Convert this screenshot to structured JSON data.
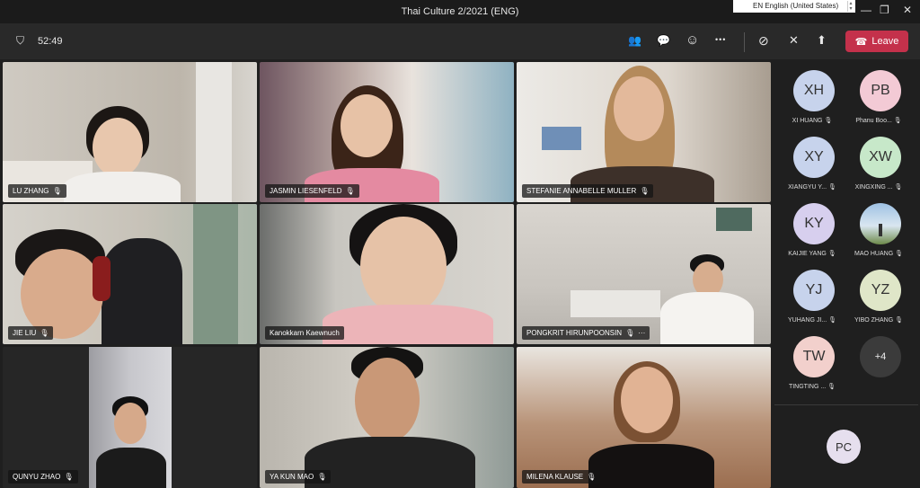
{
  "window": {
    "title": "Thai Culture 2/2021 (ENG)",
    "language_label": "EN English (United States)",
    "minimize_glyph": "—",
    "maximize_glyph": "❐",
    "close_glyph": "✕"
  },
  "toolbar": {
    "timer": "52:49",
    "leave_label": "Leave",
    "leave_color": "#c4314b",
    "icons": [
      "shield-icon",
      "people-icon",
      "chat-icon",
      "reactions-icon",
      "more-icon",
      "camera-off-icon",
      "mic-off-icon",
      "share-icon",
      "phone-icon"
    ],
    "more_glyph": "•••",
    "camera_glyph": "⊘",
    "mic_glyph": "✕",
    "share_glyph": "⬆",
    "people_glyph": "👥",
    "chat_glyph": "💬",
    "react_glyph": "☺",
    "shield_glyph": "⛉",
    "phone_glyph": "☎"
  },
  "tiles": [
    {
      "name": "LU ZHANG"
    },
    {
      "name": "JASMIN LIESENFELD"
    },
    {
      "name": "STEFANIE ANNABELLE MULLER"
    },
    {
      "name": "JIE LIU"
    },
    {
      "name": "Kanokkarn Kaewnuch"
    },
    {
      "name": "PONGKRIT HIRUNPOONSIN",
      "extra": "···"
    },
    {
      "name": "QUNYU ZHAO"
    },
    {
      "name": "YA KUN MAO"
    },
    {
      "name": "MILENA KLAUSE"
    }
  ],
  "mic_muted_glyph": "🎙",
  "participants": [
    {
      "initials": "XH",
      "name": "XI HUANG",
      "color": "#c7d3ec"
    },
    {
      "initials": "PB",
      "name": "Phanu Boo...",
      "color": "#f3cad5"
    },
    {
      "initials": "XY",
      "name": "XIANGYU Y...",
      "color": "#c7d3ec"
    },
    {
      "initials": "XW",
      "name": "XINGXING ...",
      "color": "#c7e8c9"
    },
    {
      "initials": "KY",
      "name": "KAIJIE YANG",
      "color": "#d7cfee"
    },
    {
      "initials": "",
      "name": "MAO HUANG",
      "color": "#a9c6e0"
    },
    {
      "initials": "YJ",
      "name": "YUHANG JI...",
      "color": "#c7d3ec"
    },
    {
      "initials": "YZ",
      "name": "YIBO ZHANG",
      "color": "#dfe6c8"
    },
    {
      "initials": "TW",
      "name": "TINGTING ...",
      "color": "#f2d0cc"
    },
    {
      "initials": "+4",
      "name": "",
      "color": "#3b3b3b"
    }
  ],
  "bottom_participant": {
    "initials": "PC",
    "color": "#e6dfee"
  }
}
